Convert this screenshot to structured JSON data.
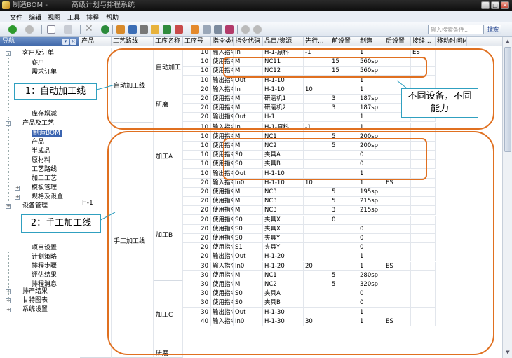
{
  "app": {
    "title": "制造BOM -",
    "subtitle": "高级计划与排程系统"
  },
  "menu": [
    "文件",
    "编辑",
    "视图",
    "工具",
    "排程",
    "帮助"
  ],
  "search": {
    "placeholder": "输入搜索条件...",
    "button": "搜索"
  },
  "nav": {
    "title": "导航",
    "items": [
      {
        "label": "客户及订单",
        "level": 0,
        "toggle": "-"
      },
      {
        "label": "客户",
        "level": 1
      },
      {
        "label": "需求订单",
        "level": 1
      },
      {
        "label": "库存增减",
        "level": 1
      },
      {
        "label": "产品及工艺",
        "level": 0,
        "toggle": "-"
      },
      {
        "label": "制造BOM",
        "level": 1,
        "selected": true
      },
      {
        "label": "产品",
        "level": 1
      },
      {
        "label": "半成品",
        "level": 1
      },
      {
        "label": "原材料",
        "level": 1
      },
      {
        "label": "工艺路线",
        "level": 1
      },
      {
        "label": "加工工艺",
        "level": 1
      },
      {
        "label": "模板管理",
        "level": 1,
        "toggle": "+"
      },
      {
        "label": "规格及设置",
        "level": 1,
        "toggle": "+"
      },
      {
        "label": "设备管理",
        "level": 0,
        "toggle": "+"
      },
      {
        "label": "项目设置",
        "level": 1
      },
      {
        "label": "计划策略",
        "level": 1
      },
      {
        "label": "排程步骤",
        "level": 1
      },
      {
        "label": "评估结果",
        "level": 1
      },
      {
        "label": "排程消息",
        "level": 1
      },
      {
        "label": "排产结果",
        "level": 0,
        "toggle": "+"
      },
      {
        "label": "甘特图表",
        "level": 0,
        "toggle": "+"
      },
      {
        "label": "系统设置",
        "level": 0,
        "toggle": "+"
      }
    ]
  },
  "grid": {
    "columns": [
      "产品",
      "工艺路线",
      "工序名称",
      "工序号",
      "指令类型",
      "指令代码",
      "品目/资源",
      "先行...",
      "前设置",
      "制造",
      "后设置",
      "接续...",
      "移动时间Min"
    ],
    "groups": {
      "product": "H-1",
      "route1": "自动加工线",
      "route2": "手工加工线",
      "ops": [
        "自动加工",
        "研磨",
        "加工A",
        "加工B",
        "加工C",
        "研磨"
      ]
    },
    "rows": [
      [
        "10",
        "输入指令",
        "In",
        "H-1-原料",
        "-1",
        "",
        "1",
        "",
        ""
      ],
      [
        "10",
        "使用指令",
        "M",
        "NC11",
        "",
        "15",
        "560sp",
        "",
        ""
      ],
      [
        "10",
        "使用指令",
        "M",
        "NC12",
        "",
        "15",
        "560sp",
        "",
        ""
      ],
      [
        "10",
        "输出指令",
        "Out",
        "H-1-10",
        "",
        "",
        "1",
        "",
        ""
      ],
      [
        "20",
        "输入指令",
        "In",
        "H-1-10",
        "10",
        "",
        "1",
        "",
        ""
      ],
      [
        "20",
        "使用指令",
        "M",
        "研磨机1",
        "",
        "3",
        "187sp",
        "",
        ""
      ],
      [
        "20",
        "使用指令",
        "M",
        "研磨机2",
        "",
        "3",
        "187sp",
        "",
        ""
      ],
      [
        "20",
        "输出指令",
        "Out",
        "H-1",
        "",
        "",
        "1",
        "",
        ""
      ],
      [
        "10",
        "输入指令",
        "In",
        "H-1-原料",
        "-1",
        "",
        "1",
        "",
        ""
      ],
      [
        "10",
        "使用指令",
        "M",
        "NC1",
        "",
        "5",
        "200sp",
        "",
        ""
      ],
      [
        "10",
        "使用指令",
        "M",
        "NC2",
        "",
        "5",
        "200sp",
        "",
        ""
      ],
      [
        "10",
        "使用指令",
        "S0",
        "夹具A",
        "",
        "",
        "0",
        "",
        ""
      ],
      [
        "10",
        "使用指令",
        "S0",
        "夹具B",
        "",
        "",
        "0",
        "",
        ""
      ],
      [
        "10",
        "输出指令",
        "Out",
        "H-1-10",
        "",
        "",
        "1",
        "",
        ""
      ],
      [
        "20",
        "输入指令",
        "In0",
        "H-1-10",
        "10",
        "",
        "1",
        "ES",
        ""
      ],
      [
        "20",
        "使用指令",
        "M",
        "NC3",
        "",
        "5",
        "195sp",
        "",
        ""
      ],
      [
        "20",
        "使用指令",
        "M",
        "NC3",
        "",
        "5",
        "215sp",
        "",
        ""
      ],
      [
        "20",
        "使用指令",
        "M",
        "NC3",
        "",
        "3",
        "215sp",
        "",
        ""
      ],
      [
        "20",
        "使用指令",
        "S0",
        "夹具X",
        "",
        "0",
        "",
        "",
        ""
      ],
      [
        "20",
        "使用指令",
        "S0",
        "夹具X",
        "",
        "",
        "0",
        "",
        ""
      ],
      [
        "20",
        "使用指令",
        "S0",
        "夹具Y",
        "",
        "",
        "0",
        "",
        ""
      ],
      [
        "20",
        "使用指令",
        "S1",
        "夹具Y",
        "",
        "",
        "0",
        "",
        ""
      ],
      [
        "20",
        "输出指令",
        "Out",
        "H-1-20",
        "",
        "",
        "1",
        "",
        ""
      ],
      [
        "30",
        "输入指令",
        "In0",
        "H-1-20",
        "20",
        "",
        "1",
        "ES",
        ""
      ],
      [
        "30",
        "使用指令",
        "M",
        "NC1",
        "",
        "5",
        "280sp",
        "",
        ""
      ],
      [
        "30",
        "使用指令",
        "M",
        "NC2",
        "",
        "5",
        "320sp",
        "",
        ""
      ],
      [
        "30",
        "使用指令",
        "S0",
        "夹具A",
        "",
        "",
        "0",
        "",
        ""
      ],
      [
        "30",
        "使用指令",
        "S0",
        "夹具B",
        "",
        "",
        "0",
        "",
        ""
      ],
      [
        "30",
        "输出指令",
        "Out",
        "H-1-30",
        "",
        "",
        "1",
        "",
        ""
      ],
      [
        "40",
        "输入指令",
        "In0",
        "H-1-30",
        "30",
        "",
        "1",
        "ES",
        ""
      ]
    ],
    "first_row_es": "ES"
  },
  "annotations": {
    "callout1": "1：自动加工线",
    "callout2": "2：手工加工线",
    "callout3": "不同设备，不同能力",
    "accent": "#e07020"
  }
}
